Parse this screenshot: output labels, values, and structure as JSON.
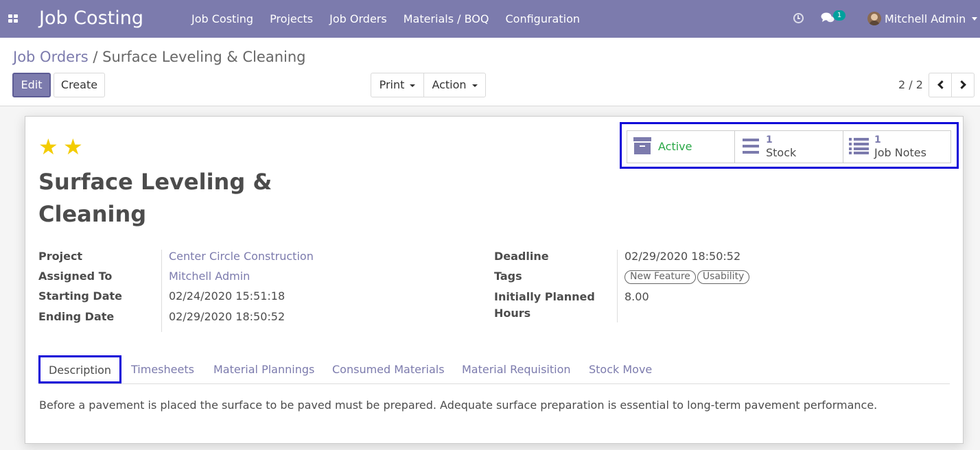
{
  "navbar": {
    "app_title": "Job Costing",
    "menu": [
      "Job Costing",
      "Projects",
      "Job Orders",
      "Materials / BOQ",
      "Configuration"
    ],
    "messages_count": "1",
    "user_name": "Mitchell Admin"
  },
  "breadcrumb": {
    "parent": "Job Orders",
    "separator": "/",
    "current": "Surface Leveling & Cleaning"
  },
  "toolbar": {
    "edit_label": "Edit",
    "create_label": "Create",
    "print_label": "Print",
    "action_label": "Action",
    "pager": "2 / 2"
  },
  "record": {
    "priority_stars": 2,
    "title": "Surface Leveling & Cleaning",
    "smart_buttons": {
      "active_label": "Active",
      "stock_count": "1",
      "stock_label": "Stock",
      "notes_count": "1",
      "notes_label": "Job Notes"
    },
    "left_fields": [
      {
        "label": "Project",
        "value": "Center Circle Construction"
      },
      {
        "label": "Assigned To",
        "value": "Mitchell Admin"
      },
      {
        "label": "Starting Date",
        "value": "02/24/2020 15:51:18"
      },
      {
        "label": "Ending Date",
        "value": "02/29/2020 18:50:52"
      }
    ],
    "right_fields": {
      "deadline_label": "Deadline",
      "deadline_value": "02/29/2020 18:50:52",
      "tags_label": "Tags",
      "tags": [
        "New Feature",
        "Usability"
      ],
      "hours_label_line1": "Initially Planned",
      "hours_label_line2": "Hours",
      "hours_value": "8.00"
    },
    "tabs": [
      "Description",
      "Timesheets",
      "Material Plannings",
      "Consumed Materials",
      "Material Requisition",
      "Stock Move"
    ],
    "active_tab": "Description",
    "description": "Before a pavement is placed the surface to be paved must be prepared. Adequate surface preparation is essential to long-term pavement performance."
  },
  "colors": {
    "brand": "#7c7bad",
    "active_green": "#28a745",
    "highlight_blue": "#0c00d8",
    "star_yellow": "#f3cc00",
    "badge_teal": "#00a09d"
  }
}
